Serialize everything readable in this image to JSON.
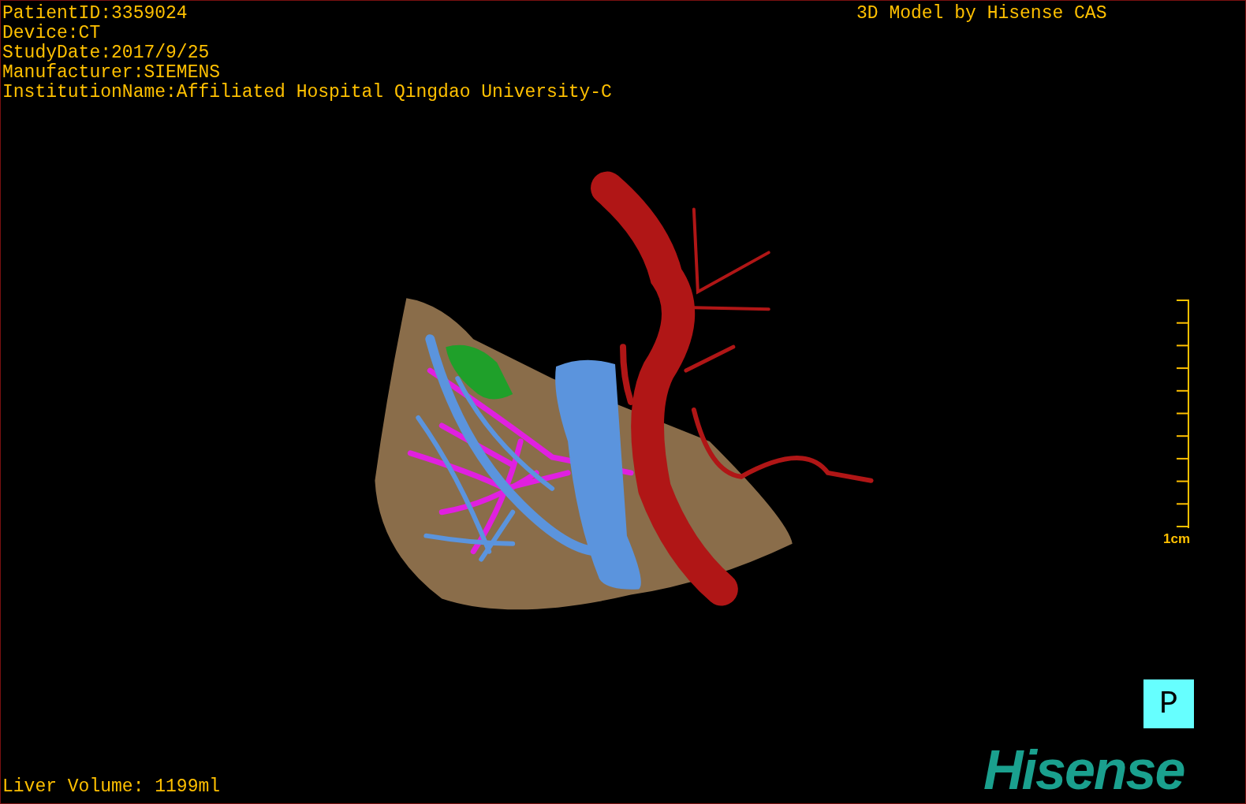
{
  "patient_info": [
    "PatientID:3359024",
    "Device:CT",
    "StudyDate:2017/9/25",
    "Manufacturer:SIEMENS",
    "InstitutionName:Affiliated Hospital Qingdao University-C"
  ],
  "model_credit": "3D Model by Hisense CAS",
  "scale_bar": {
    "label": "1cm"
  },
  "orientation_marker": "P",
  "liver_volume": "Liver Volume: 1199ml",
  "logo": "Hisense"
}
